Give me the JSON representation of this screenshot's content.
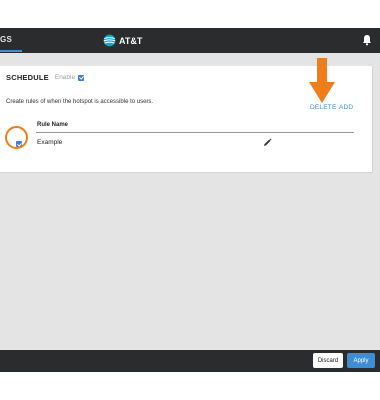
{
  "header": {
    "page_label": "GS",
    "brand": "AT&T",
    "icons": {
      "brand": "att-globe-icon",
      "notifications": "bell-icon"
    }
  },
  "schedule": {
    "title": "SCHEDULE",
    "enable_label": "Enable",
    "enabled": true,
    "description": "Create rules of when the hotspot is accessible to users.",
    "actions": {
      "delete": "DELETE",
      "add": "ADD"
    },
    "columns": {
      "rule_name": "Rule Name"
    },
    "rules": [
      {
        "name": "Example",
        "selected": true,
        "edit_icon": "pencil-icon"
      }
    ]
  },
  "footer": {
    "discard": "Discard",
    "apply": "Apply"
  },
  "colors": {
    "header_bg": "#2b2c2e",
    "accent": "#3f8ed1",
    "annotation": "#ef7d1a",
    "workspace_bg": "#e4e4e4"
  }
}
